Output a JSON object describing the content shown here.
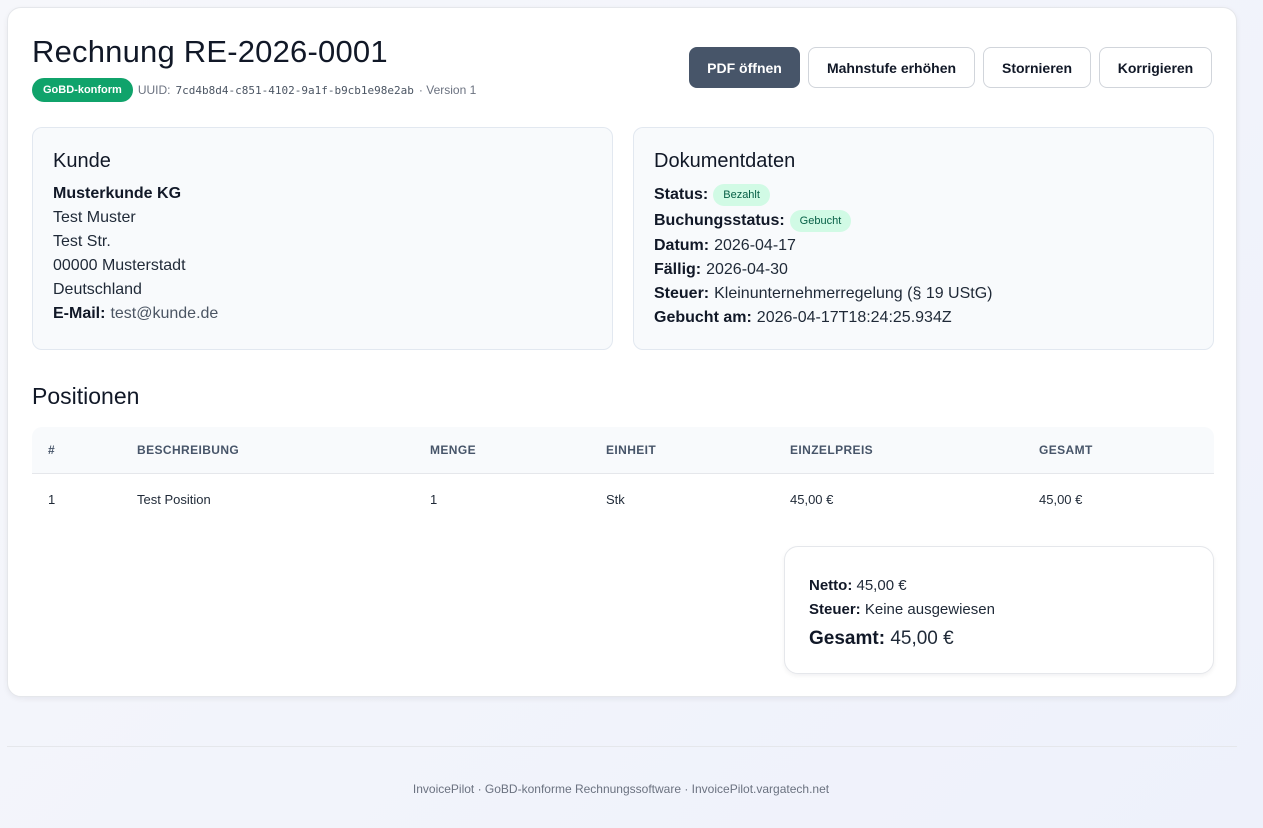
{
  "header": {
    "title": "Rechnung RE-2026-0001",
    "badge": "GoBD-konform",
    "uuid_label": "UUID:",
    "uuid": "7cd4b8d4-c851-4102-9a1f-b9cb1e98e2ab",
    "version": "· Version 1"
  },
  "actions": {
    "pdf": "PDF öffnen",
    "dunning": "Mahnstufe erhöhen",
    "cancel": "Stornieren",
    "correct": "Korrigieren"
  },
  "customer": {
    "heading": "Kunde",
    "name": "Musterkunde KG",
    "contact": "Test Muster",
    "street": "Test Str.",
    "city": "00000 Musterstadt",
    "country": "Deutschland",
    "email_label": "E-Mail:",
    "email": "test@kunde.de"
  },
  "document": {
    "heading": "Dokumentdaten",
    "status_label": "Status:",
    "status": "Bezahlt",
    "booking_label": "Buchungsstatus:",
    "booking": "Gebucht",
    "date_label": "Datum:",
    "date": "2026-04-17",
    "due_label": "Fällig:",
    "due": "2026-04-30",
    "tax_label": "Steuer:",
    "tax": "Kleinunternehmerregelung (§ 19 UStG)",
    "booked_label": "Gebucht am:",
    "booked": "2026-04-17T18:24:25.934Z"
  },
  "positions": {
    "heading": "Positionen",
    "columns": [
      "#",
      "BESCHREIBUNG",
      "MENGE",
      "EINHEIT",
      "EINZELPREIS",
      "GESAMT"
    ],
    "rows": [
      [
        "1",
        "Test Position",
        "1",
        "Stk",
        "45,00 €",
        "45,00 €"
      ]
    ]
  },
  "totals": {
    "net_label": "Netto:",
    "net": "45,00 €",
    "tax_label": "Steuer:",
    "tax": "Keine ausgewiesen",
    "total_label": "Gesamt:",
    "total": "45,00 €"
  },
  "footer": "InvoicePilot · GoBD-konforme Rechnungssoftware · InvoicePilot.vargatech.net",
  "colors": {
    "primary_button": "#475569",
    "gobd_badge": "#10a36b",
    "status_badge_bg": "#d1fae5"
  }
}
